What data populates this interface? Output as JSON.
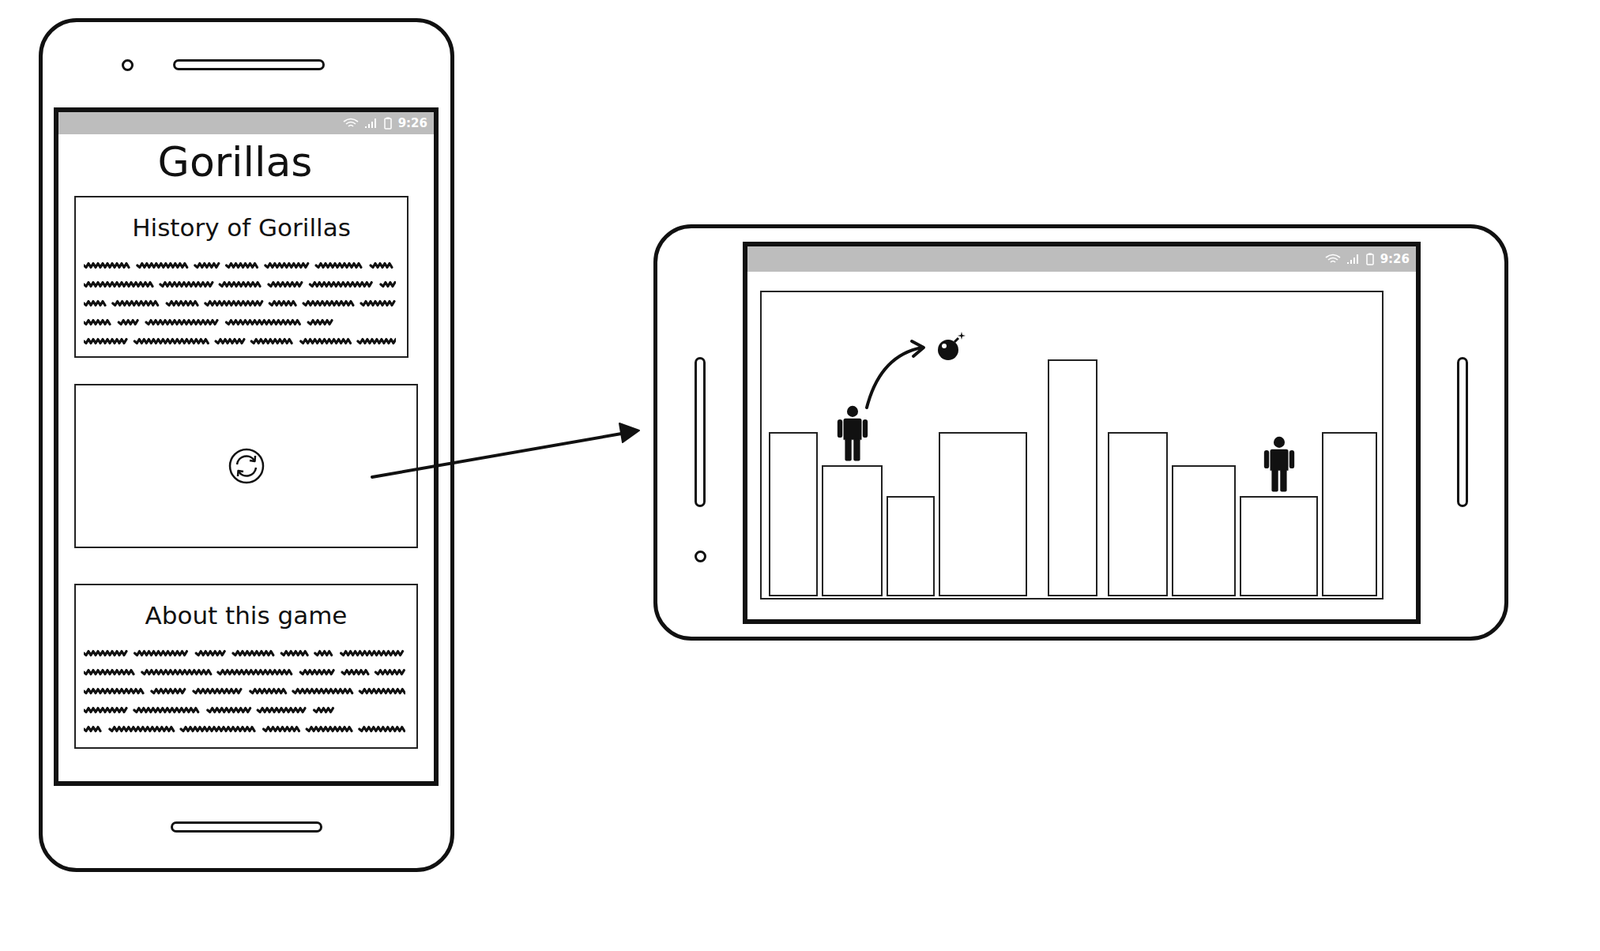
{
  "left_phone": {
    "status_bar": {
      "time": "9:26"
    },
    "title": "Gorillas",
    "history": {
      "title": "History of Gorillas"
    },
    "about": {
      "title": "About this game"
    }
  },
  "right_phone": {
    "status_bar": {
      "time": "9:26"
    },
    "game": {
      "buildings": [
        {
          "level": 0.54,
          "has_gorilla": false
        },
        {
          "level": 0.43,
          "has_gorilla": true
        },
        {
          "level": 0.33,
          "has_gorilla": false
        },
        {
          "level": 0.54,
          "has_gorilla": false
        },
        {
          "level": 0.78,
          "has_gorilla": false
        },
        {
          "level": 0.54,
          "has_gorilla": false
        },
        {
          "level": 0.43,
          "has_gorilla": false
        },
        {
          "level": 0.33,
          "has_gorilla": true
        },
        {
          "level": 0.54,
          "has_gorilla": false
        }
      ]
    }
  }
}
